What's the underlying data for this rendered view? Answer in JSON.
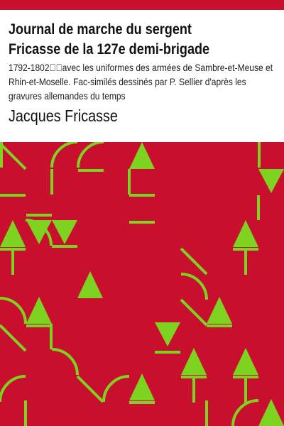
{
  "cover": {
    "title": "Journal de marche du sergent Fricasse de la 127e demi-brigade",
    "subtitle": "1792-1802\u0000\u0000avec les uniformes des armées de Sambre-et-Meuse et Rhin-et-Moselle. Fac-similés dessinés par P. Sellier d'après les gravures allemandes du temps",
    "author": "Jacques Fricasse"
  },
  "colors": {
    "background": "#c8102e",
    "pattern": "#7ed321",
    "text": "#111111"
  }
}
